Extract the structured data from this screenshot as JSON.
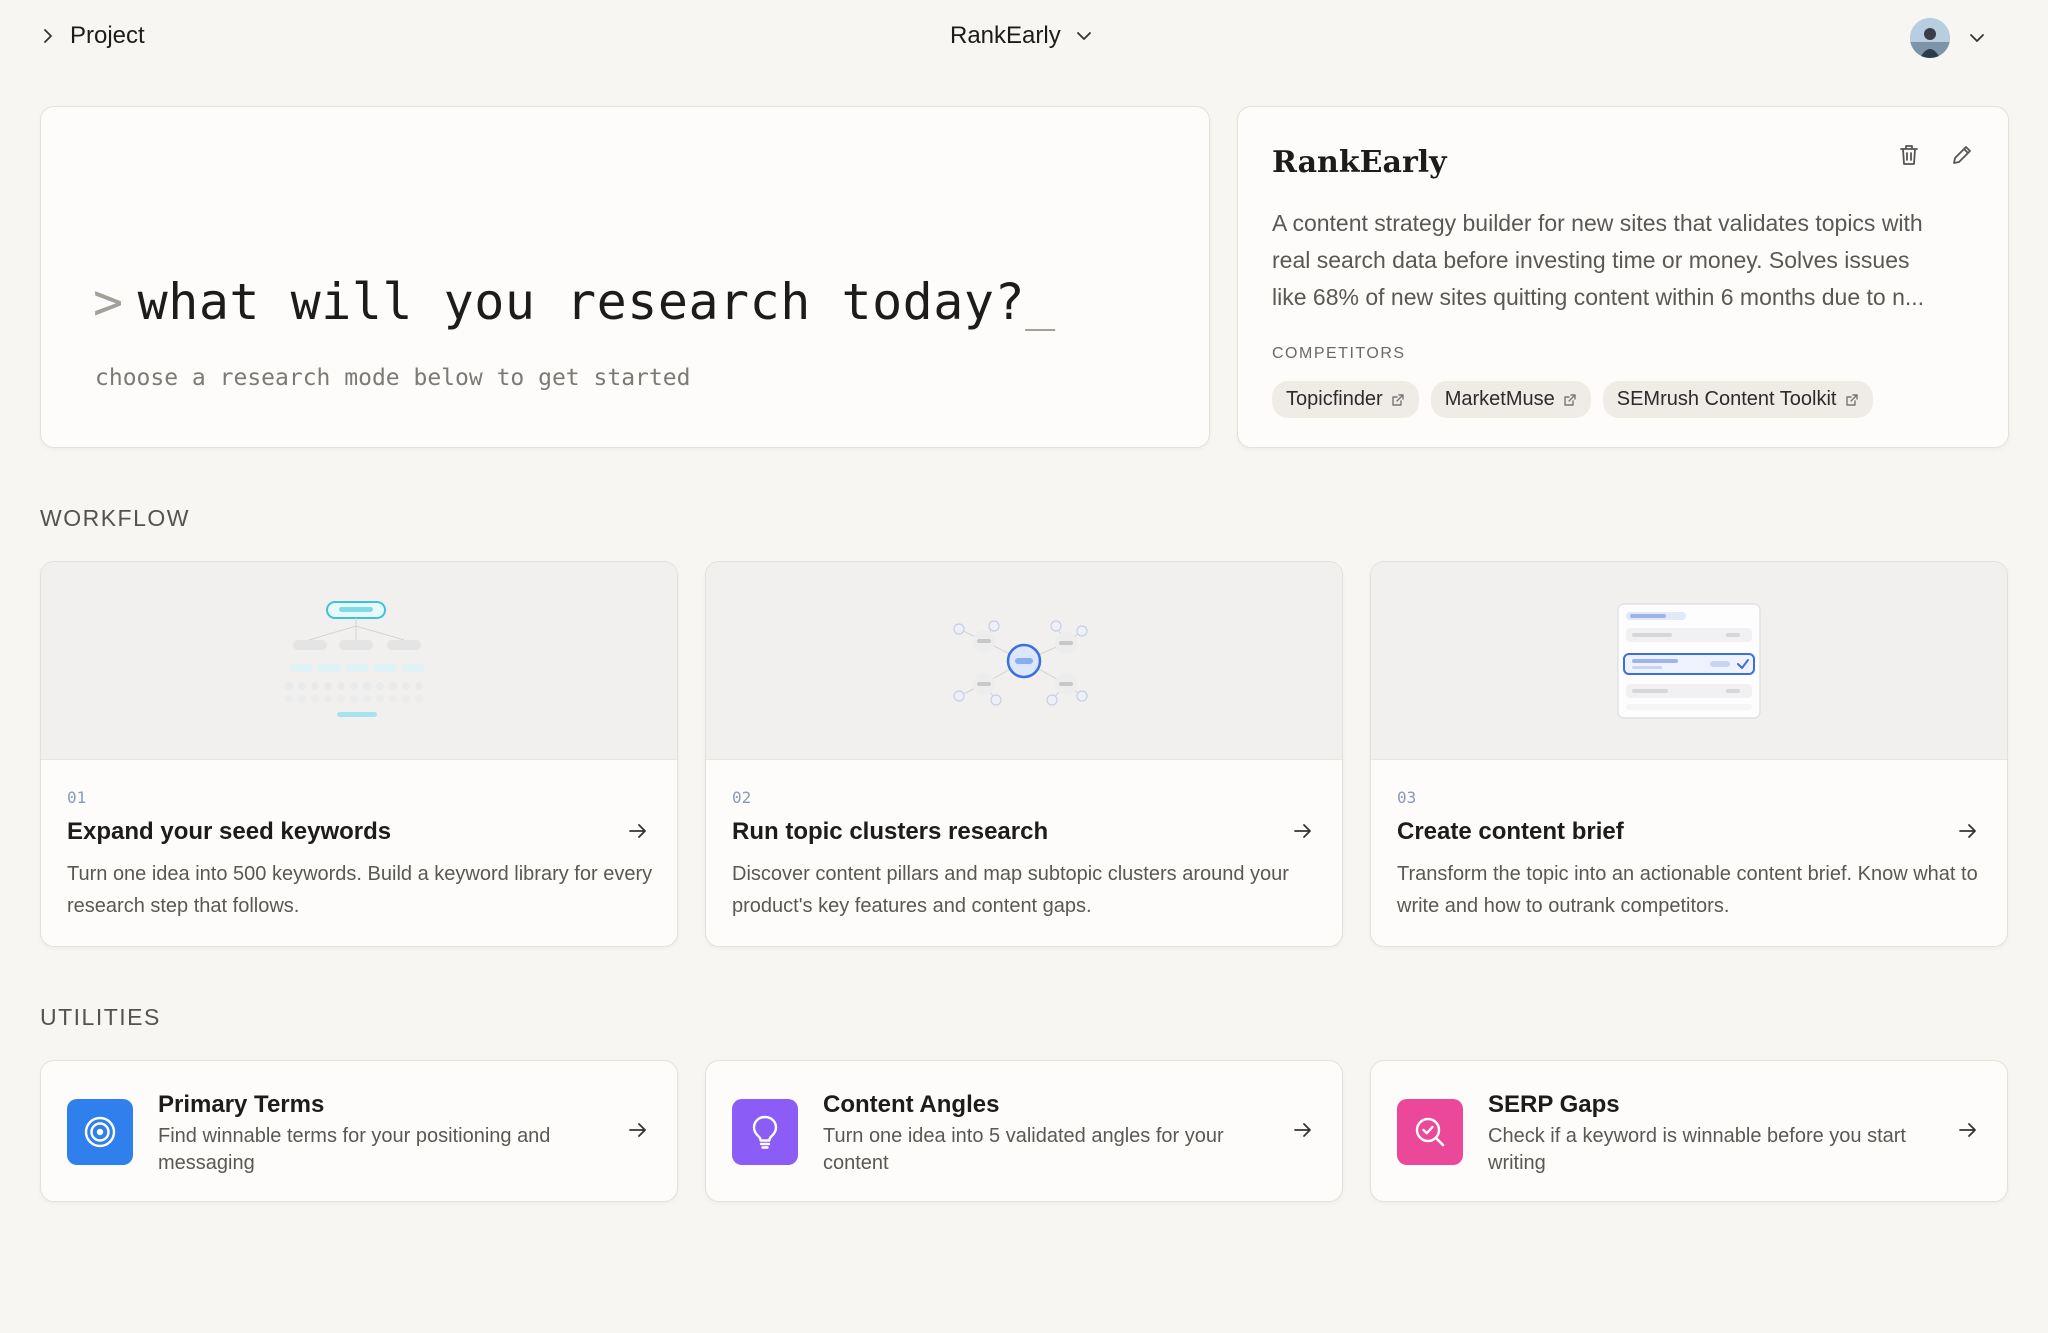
{
  "header": {
    "breadcrumb": "Project",
    "project_name": "RankEarly"
  },
  "hero": {
    "prompt_symbol": ">",
    "prompt": "what will you research today?",
    "cursor": "_",
    "subtitle": "choose a research mode below to get started"
  },
  "project": {
    "title": "RankEarly",
    "description_lines": [
      "A content strategy builder for new sites that validates topics with",
      "real search data before investing time or money. Solves issues",
      "like 68% of new sites quitting content within 6 months due to n..."
    ],
    "competitors_label": "COMPETITORS",
    "competitors": [
      "Topicfinder",
      "MarketMuse",
      "SEMrush Content Toolkit"
    ]
  },
  "workflow": {
    "label": "WORKFLOW",
    "items": [
      {
        "num": "01",
        "title": "Expand your seed keywords",
        "desc": "Turn one idea into 500 keywords. Build a keyword library for every research step that follows."
      },
      {
        "num": "02",
        "title": "Run topic clusters research",
        "desc": "Discover content pillars and map subtopic clusters around your product's key features and content gaps."
      },
      {
        "num": "03",
        "title": "Create content brief",
        "desc": "Transform the topic into an actionable content brief. Know what to write and how to outrank competitors."
      }
    ]
  },
  "utilities": {
    "label": "UTILITIES",
    "items": [
      {
        "title": "Primary Terms",
        "desc": "Find winnable terms for your positioning and messaging",
        "icon": "target-icon",
        "color": "#2f80ed"
      },
      {
        "title": "Content Angles",
        "desc": "Turn one idea into 5 validated angles for your content",
        "icon": "lightbulb-icon",
        "color": "#8b5cf6"
      },
      {
        "title": "SERP Gaps",
        "desc": "Check if a keyword is winnable before you start writing",
        "icon": "search-check-icon",
        "color": "#ec4899"
      }
    ]
  }
}
